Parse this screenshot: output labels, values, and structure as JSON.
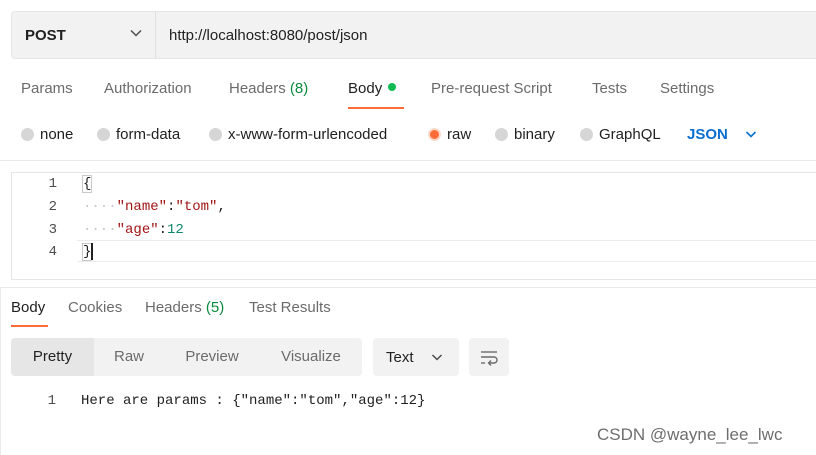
{
  "request": {
    "method": "POST",
    "url": "http://localhost:8080/post/json"
  },
  "request_tabs": [
    {
      "label": "Params"
    },
    {
      "label": "Authorization"
    },
    {
      "label": "Headers",
      "count": "(8)"
    },
    {
      "label": "Body"
    },
    {
      "label": "Pre-request Script"
    },
    {
      "label": "Tests"
    },
    {
      "label": "Settings"
    }
  ],
  "body_types": [
    {
      "label": "none",
      "selected": false
    },
    {
      "label": "form-data",
      "selected": false
    },
    {
      "label": "x-www-form-urlencoded",
      "selected": false
    },
    {
      "label": "raw",
      "selected": true
    },
    {
      "label": "binary",
      "selected": false
    },
    {
      "label": "GraphQL",
      "selected": false
    }
  ],
  "raw_language": "JSON",
  "editor": {
    "line_numbers": [
      "1",
      "2",
      "3",
      "4"
    ],
    "open_brace": "{",
    "close_brace": "}",
    "indent": "····",
    "line2_key": "\"name\"",
    "line2_sep": ":",
    "line2_value": "\"tom\"",
    "line2_tail": ",",
    "line3_key": "\"age\"",
    "line3_sep": ":",
    "line3_value": "12"
  },
  "response_tabs": [
    {
      "label": "Body"
    },
    {
      "label": "Cookies"
    },
    {
      "label": "Headers",
      "count": "(5)"
    },
    {
      "label": "Test Results"
    }
  ],
  "view_modes": [
    "Pretty",
    "Raw",
    "Preview",
    "Visualize"
  ],
  "format": "Text",
  "response": {
    "line_number": "1",
    "text": "Here are params : {\"name\":\"tom\",\"age\":12}"
  },
  "watermark": "CSDN @wayne_lee_lwc",
  "colors": {
    "accent": "#ff6c37",
    "body_dot": "#0cbb52",
    "json_label": "#0b6fd1"
  }
}
